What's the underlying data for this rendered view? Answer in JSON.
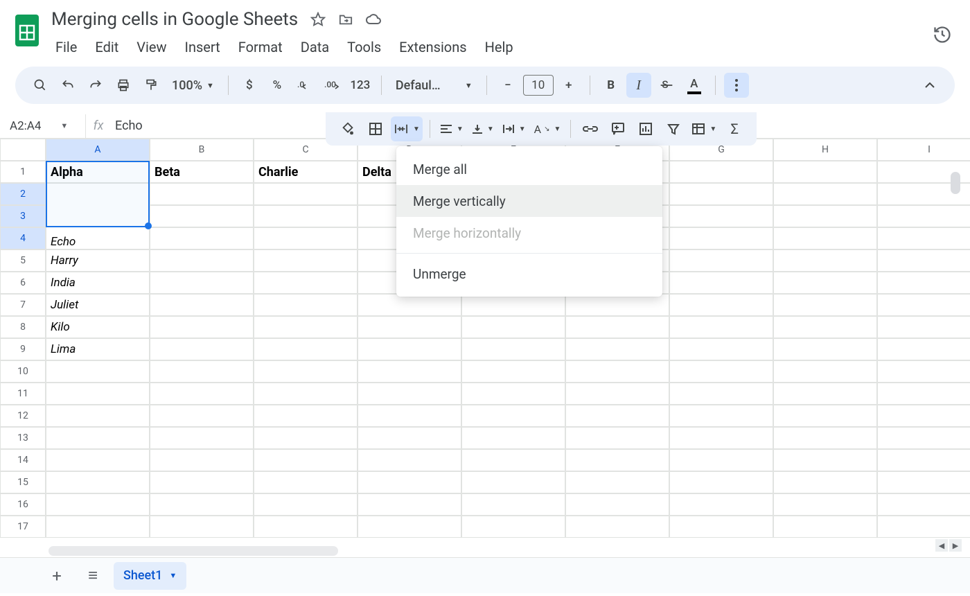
{
  "doc": {
    "title": "Merging cells in Google Sheets"
  },
  "menus": [
    "File",
    "Edit",
    "View",
    "Insert",
    "Format",
    "Data",
    "Tools",
    "Extensions",
    "Help"
  ],
  "toolbar": {
    "zoom": "100%",
    "font": "Defaul…",
    "size": "10",
    "currency": "$",
    "percent": "%",
    "decdec": ".0",
    "decinc": ".00",
    "numfmt": "123",
    "minus": "−",
    "plus": "+",
    "bold": "B",
    "italic": "I"
  },
  "toolbar2": {},
  "namebox": {
    "range": "A2:A4",
    "fx": "Echo"
  },
  "columns": [
    "A",
    "B",
    "C",
    "D",
    "E",
    "F",
    "G",
    "H",
    "I"
  ],
  "rows": [
    "1",
    "2",
    "3",
    "4",
    "5",
    "6",
    "7",
    "8",
    "9",
    "10",
    "11",
    "12",
    "13",
    "14",
    "15",
    "16",
    "17"
  ],
  "headers": {
    "A": "Alpha",
    "B": "Beta",
    "C": "Charlie",
    "D": "Delta"
  },
  "merged": {
    "range": "A2:A4",
    "value": "Echo"
  },
  "colA": {
    "5": "Harry",
    "6": "India",
    "7": "Juliet",
    "8": "Kilo",
    "9": "Lima"
  },
  "mergeMenu": {
    "all": "Merge all",
    "vert": "Merge vertically",
    "horiz": "Merge horizontally",
    "unmerge": "Unmerge"
  },
  "tabs": {
    "sheet1": "Sheet1"
  }
}
